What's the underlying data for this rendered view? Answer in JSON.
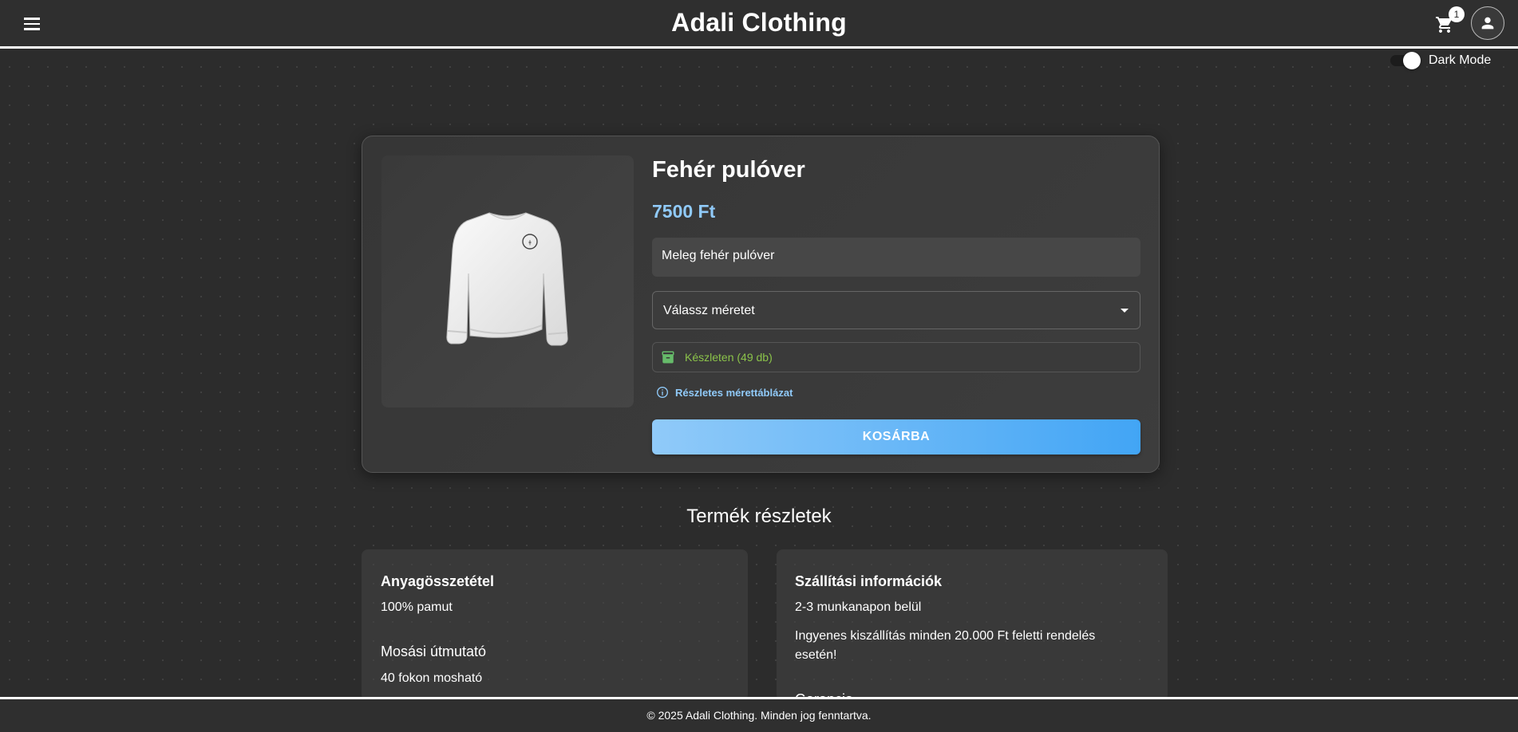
{
  "header": {
    "brand": "Adali Clothing",
    "cart_count": "1"
  },
  "theme_toggle": {
    "label": "Dark Mode",
    "enabled": true
  },
  "product": {
    "title": "Fehér pulóver",
    "price": "7500 Ft",
    "description": "Meleg fehér pulóver",
    "size_select_placeholder": "Válassz méretet",
    "stock_text": "Készleten (49 db)",
    "size_chart_link": "Részletes mérettáblázat",
    "add_to_cart": "KOSÁRBA",
    "image_alt": "white-sweater-image"
  },
  "details": {
    "heading": "Termék részletek",
    "left": {
      "material_title": "Anyagösszetétel",
      "material_value": "100% pamut",
      "washing_title": "Mosási útmutató",
      "washing_value": "40 fokon mosható"
    },
    "right": {
      "shipping_title": "Szállítási információk",
      "shipping_time": "2-3 munkanapon belül",
      "shipping_free": "Ingyenes kiszállítás minden 20.000 Ft feletti rendelés esetén!",
      "warranty_title": "Garancia"
    }
  },
  "footer": {
    "text": "© 2025 Adali Clothing. Minden jog fenntartva."
  },
  "colors": {
    "accent": "#90caf9",
    "button_end": "#42a5f5",
    "stock_green": "#8bc34a",
    "background": "#2c2c2c"
  }
}
